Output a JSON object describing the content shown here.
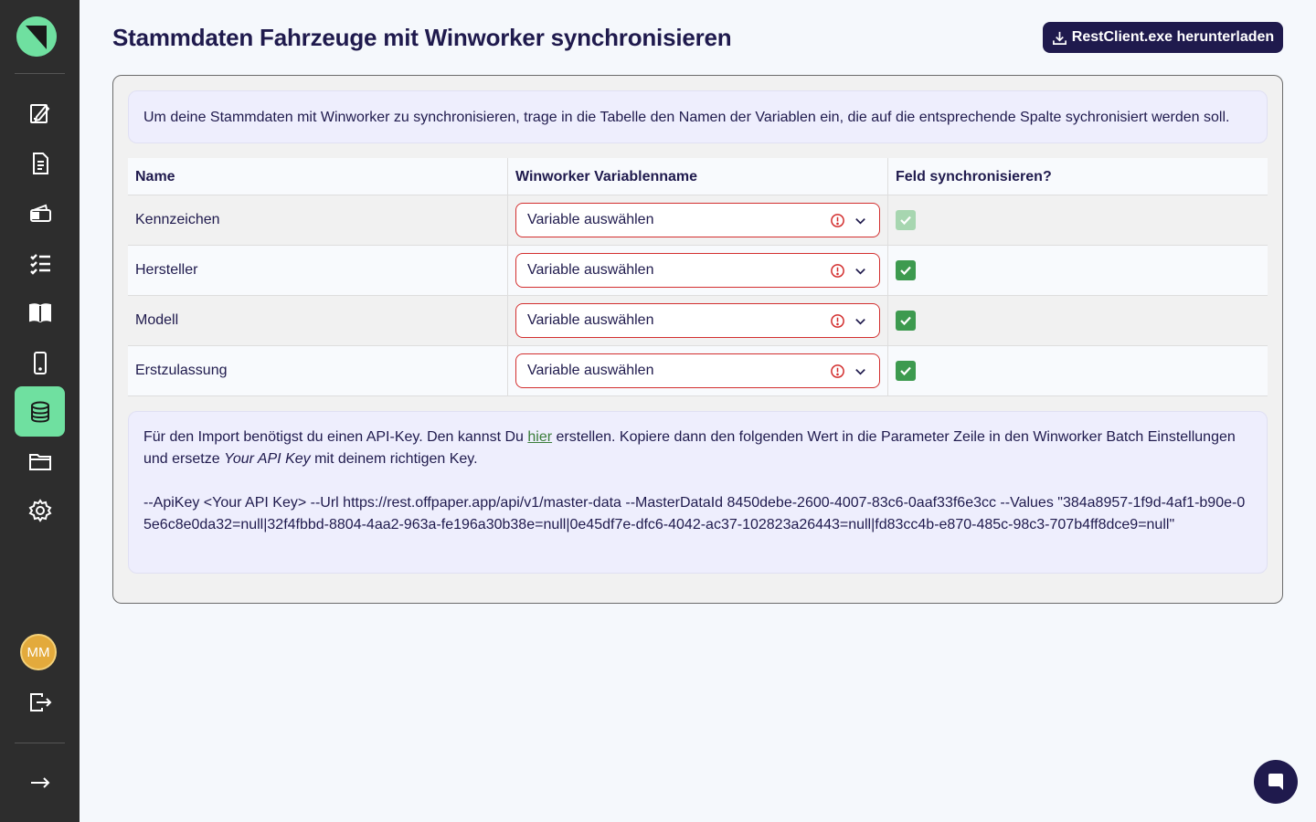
{
  "header": {
    "title": "Stammdaten Fahrzeuge mit Winworker synchronisieren",
    "download_label": "RestClient.exe herunterladen"
  },
  "sidebar": {
    "avatar_initials": "MM",
    "items": [
      {
        "icon": "edit-document-icon"
      },
      {
        "icon": "document-icon"
      },
      {
        "icon": "wallet-icon"
      },
      {
        "icon": "checklist-icon"
      },
      {
        "icon": "book-icon"
      },
      {
        "icon": "phone-icon"
      },
      {
        "icon": "database-icon",
        "active": true
      },
      {
        "icon": "folder-icon"
      },
      {
        "icon": "gear-icon"
      }
    ]
  },
  "intro_text": "Um deine Stammdaten mit Winworker zu synchronisieren, trage in die Tabelle den Namen der Variablen ein, die auf die entsprechende Spalte sychronisiert werden soll.",
  "table": {
    "headers": [
      "Name",
      "Winworker Variablenname",
      "Feld synchronisieren?"
    ],
    "rows": [
      {
        "name": "Kennzeichen",
        "select": "Variable auswählen",
        "sync": true,
        "disabled": true
      },
      {
        "name": "Hersteller",
        "select": "Variable auswählen",
        "sync": true,
        "disabled": false
      },
      {
        "name": "Modell",
        "select": "Variable auswählen",
        "sync": true,
        "disabled": false
      },
      {
        "name": "Erstzulassung",
        "select": "Variable auswählen",
        "sync": true,
        "disabled": false
      }
    ]
  },
  "import_info": {
    "text_before_link": "Für den Import benötigst du einen API-Key. Den kannst Du ",
    "link_label": "hier",
    "text_after_link": " erstellen. Kopiere dann den folgenden Wert in die Parameter Zeile in den Winworker Batch Einstellungen und ersetze ",
    "italic": "Your API Key",
    "text_end": " mit deinem richtigen Key.",
    "command": "--ApiKey <Your API Key> --Url https://rest.offpaper.app/api/v1/master-data --MasterDataId 8450debe-2600-4007-83c6-0aaf33f6e3cc --Values \"384a8957-1f9d-4af1-b90e-05e6c8e0da32=null|32f4fbbd-8804-4aa2-963a-fe196a30b38e=null|0e45df7e-dfc6-4042-ac37-102823a26443=null|fd83cc4b-e870-485c-98c3-707b4ff8dce9=null\""
  },
  "colors": {
    "sidebar_bg": "#2d2d2d",
    "accent": "#6fe0a0",
    "primary": "#1f1a4d",
    "error": "#d32f2f",
    "check": "#3d9a4f"
  }
}
